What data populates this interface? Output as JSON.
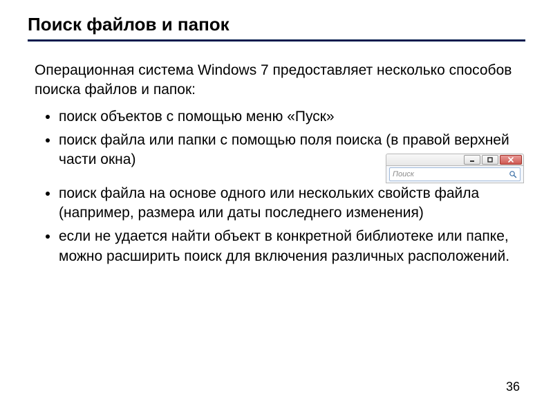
{
  "title": "Поиск файлов и папок",
  "intro": "Операционная система Windows 7 предоставляет несколько способов поиска файлов и папок:",
  "bullets_top": [
    "поиск объектов с помощью меню «Пуск»",
    "поиск файла или папки с помощью поля поиска (в правой верхней части окна)"
  ],
  "bullets_bottom": [
    "поиск файла на основе одного или нескольких свойств файла (например, размера или даты последнего изменения)",
    "если не удается найти объект в конкретной библиотеке или папке, можно расширить поиск для включения различных расположений."
  ],
  "search_widget": {
    "placeholder": "Поиск"
  },
  "page_number": "36"
}
